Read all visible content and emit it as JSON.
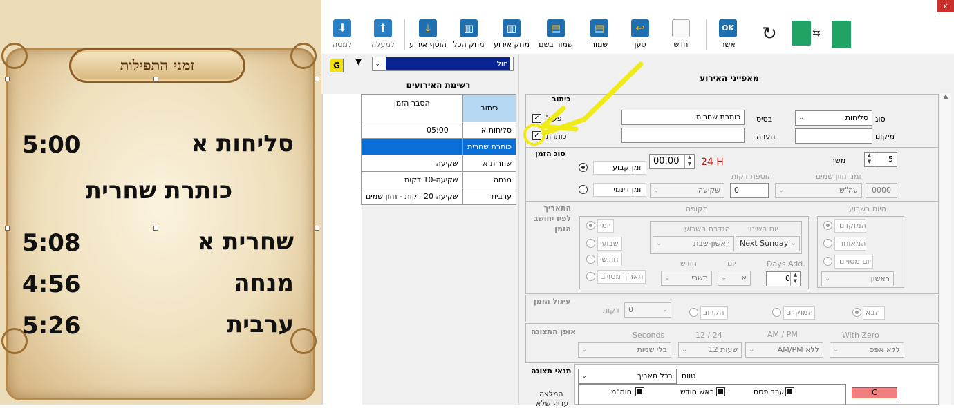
{
  "preview": {
    "banner_title": "זמני התפילות",
    "rows": [
      {
        "name": "סליחות א",
        "time": "5:00"
      },
      {
        "name": "כותרת שחרית",
        "time": ""
      },
      {
        "name": "שחרית א",
        "time": "5:08"
      },
      {
        "name": "מנחה",
        "time": "4:56"
      },
      {
        "name": "ערבית",
        "time": "5:26"
      }
    ]
  },
  "toolbar": {
    "down": "למטה",
    "up": "למעלה",
    "add_event": "הוסף אירוע",
    "delete_all": "מחק הכל",
    "delete_event": "מחק אירוע",
    "save_as": "שמור בשם",
    "save": "שמור",
    "load": "טען",
    "new": "חדש",
    "ok": "אשר",
    "close": "x"
  },
  "list": {
    "g_button": "G",
    "filter_value": "חול",
    "title": "רשימת האירועים",
    "col_caption": "כיתוב",
    "col_explain": "הסבר הזמן",
    "rows": [
      {
        "caption": "סליחות א",
        "explain": "05:00"
      },
      {
        "caption": "כותרת שחרית",
        "explain": ""
      },
      {
        "caption": "שחרית א",
        "explain": "שקיעה"
      },
      {
        "caption": "מנחה",
        "explain": "שקיעה-10 דקות"
      },
      {
        "caption": "ערבית",
        "explain": "שקיעה 20 דקות - חזון שמים"
      }
    ]
  },
  "props": {
    "title": "מאפייני האירוע",
    "caption_group": "כיתוב",
    "type_label": "סוג",
    "type_value": "סליחות",
    "base_label": "בסיס",
    "base_value": "כותרת שחרית",
    "location_label": "מיקום",
    "location_value": "",
    "note_label": "הערה",
    "note_value": "",
    "active_label": "פעיל",
    "title_label": "כותרת",
    "time_type_group": "סוג הזמן",
    "duration_label": "משך",
    "duration_value": "5",
    "fixed_time_label": "זמן קבוע",
    "fixed_time_value": "00:00",
    "h24": "24 H",
    "dynamic_time_label": "זמן דינמי",
    "dynamic_value": "שקיעה",
    "add_minutes_label": "הוספת דקות",
    "add_minutes_value": "0",
    "chazon_label": "זמני חוון שמים",
    "chazon_value": "עה\"ש",
    "chazon_num": "0000",
    "date_calc_group": "התאריך לפיו יחושב הזמן",
    "weekday_group": "היום בשבוע",
    "earlier": "המוקדם",
    "later": "המאוחר",
    "specific_day": "יום מסויים",
    "day_value": "ראשון",
    "period_group": "תקופה",
    "daily": "יומי",
    "weekly": "שבועי",
    "monthly": "חודשי",
    "specific_date": "תאריך מסויים",
    "week_def_label": "הגדרת השבוע",
    "week_def_value": "ראשון-שבת",
    "change_day_label": "יום השינוי",
    "change_day_value": "Next Sunday",
    "month_label": "חודש",
    "month_value": "תשרי",
    "day_label": "יום",
    "day_letter": "א",
    "days_add_label": "Days Add.",
    "days_add_value": "0",
    "rounding_group": "עיגול הזמן",
    "next": "הבא",
    "prev_early": "המוקדם",
    "nearest": "הקרוב",
    "minutes_label": "דקות",
    "minutes_value": "0",
    "display_group": "אופן התצוגה",
    "with_zero_label": "With Zero",
    "with_zero_value": "ללא אפס",
    "ampm_label": "AM / PM",
    "ampm_value": "ללא AM/PM",
    "h1224_label": "12 / 24",
    "h1224_value": "שעות 12",
    "seconds_label": "Seconds",
    "seconds_value": "בלי שניות",
    "cond_group": "תנאי תצוגה",
    "range_label": "טווח",
    "range_value": "בכל תאריך",
    "erev_pesach": "ערב פסח",
    "rosh_chodesh": "ראש חודש",
    "chol_hamoed": "חוה\"מ",
    "c_button": "C",
    "recommend_1": "המלצה",
    "recommend_2": "עדיף שלא"
  },
  "colors": {
    "selection_blue": "#0a6fd6",
    "header_blue": "#b7d8f2",
    "red_text": "#b0160e",
    "annotation_yellow": "#f0ea16",
    "parchment": "#efe0bd",
    "banner_text": "#5a3412"
  }
}
